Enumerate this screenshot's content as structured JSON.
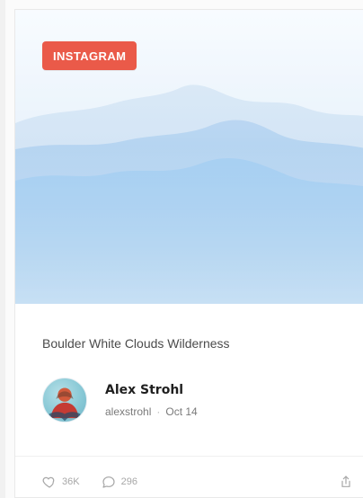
{
  "card": {
    "badge": "INSTAGRAM",
    "title": "Boulder White Clouds Wilderness",
    "author": {
      "name": "Alex Strohl",
      "handle": "alexstrohl",
      "separator": "·",
      "date": "Oct 14"
    },
    "stats": {
      "likes": "36K",
      "comments": "296"
    }
  },
  "colors": {
    "badge_bg": "#ea5a49",
    "text_primary": "#1f1f1f",
    "text_muted": "#7a7a7a",
    "icon_muted": "#a7a7a7"
  },
  "icons": {
    "like": "heart-icon",
    "comment": "comment-icon",
    "share": "share-icon"
  }
}
